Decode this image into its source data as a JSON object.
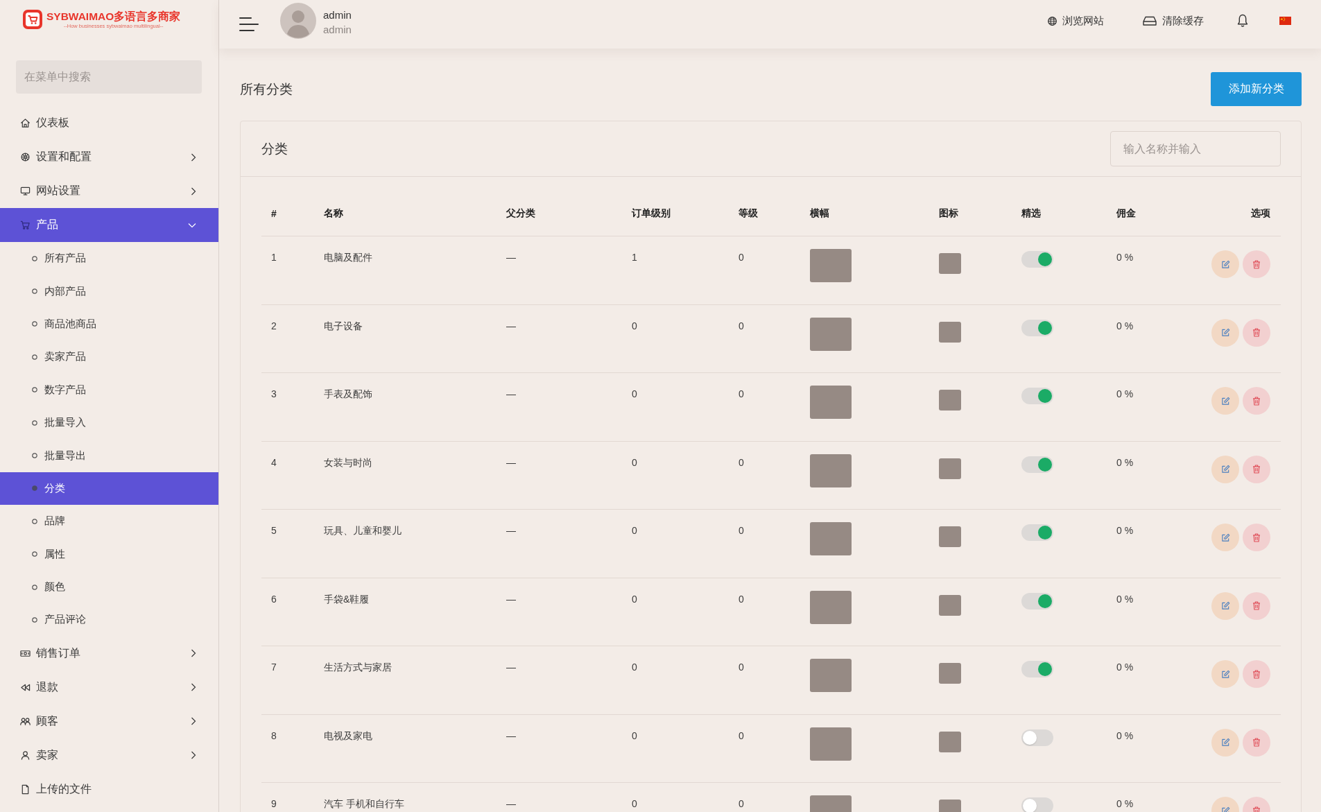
{
  "logo": {
    "title": "SYBWAIMAO多语言多商家",
    "tagline": "--How businesses sybwaimao multilingual--"
  },
  "sidebar": {
    "search": {
      "placeholder": "在菜单中搜索"
    },
    "items": [
      {
        "label": "仪表板",
        "kind": "link",
        "selected": false,
        "expanded": false
      },
      {
        "label": "设置和配置",
        "kind": "group",
        "selected": false,
        "expanded": false
      },
      {
        "label": "网站设置",
        "kind": "group",
        "selected": false,
        "expanded": false
      },
      {
        "label": "产品",
        "kind": "group",
        "selected": true,
        "expanded": true,
        "children": [
          {
            "label": "所有产品",
            "selected": false
          },
          {
            "label": "内部产品",
            "selected": false
          },
          {
            "label": "商品池商品",
            "selected": false
          },
          {
            "label": "卖家产品",
            "selected": false
          },
          {
            "label": "数字产品",
            "selected": false
          },
          {
            "label": "批量导入",
            "selected": false
          },
          {
            "label": "批量导出",
            "selected": false
          },
          {
            "label": "分类",
            "selected": true
          },
          {
            "label": "品牌",
            "selected": false
          },
          {
            "label": "属性",
            "selected": false
          },
          {
            "label": "颜色",
            "selected": false
          },
          {
            "label": "产品评论",
            "selected": false
          }
        ]
      },
      {
        "label": "销售订单",
        "kind": "group",
        "selected": false,
        "expanded": false
      },
      {
        "label": "退款",
        "kind": "group",
        "selected": false,
        "expanded": false
      },
      {
        "label": "顾客",
        "kind": "group",
        "selected": false,
        "expanded": false
      },
      {
        "label": "卖家",
        "kind": "group",
        "selected": false,
        "expanded": false
      },
      {
        "label": "上传的文件",
        "kind": "link",
        "selected": false,
        "expanded": false
      }
    ]
  },
  "header": {
    "user": {
      "name": "admin",
      "role": "admin"
    },
    "links": [
      {
        "label": "浏览网站"
      },
      {
        "label": "清除缓存"
      }
    ]
  },
  "page": {
    "title": "所有分类",
    "add_button": "添加新分类"
  },
  "card": {
    "title": "分类",
    "search": {
      "placeholder": "输入名称并输入"
    },
    "table": {
      "columns": [
        "#",
        "名称",
        "父分类",
        "订单级别",
        "等级",
        "横幅",
        "图标",
        "精选",
        "佣金",
        "选项"
      ],
      "rows": [
        {
          "number": "1",
          "name": "电脑及配件",
          "parent": "—",
          "ordering": "1",
          "rank": "0",
          "featured": true,
          "commission": "0 %"
        },
        {
          "number": "2",
          "name": "电子设备",
          "parent": "—",
          "ordering": "0",
          "rank": "0",
          "featured": true,
          "commission": "0 %"
        },
        {
          "number": "3",
          "name": "手表及配饰",
          "parent": "—",
          "ordering": "0",
          "rank": "0",
          "featured": true,
          "commission": "0 %"
        },
        {
          "number": "4",
          "name": "女装与时尚",
          "parent": "—",
          "ordering": "0",
          "rank": "0",
          "featured": true,
          "commission": "0 %"
        },
        {
          "number": "5",
          "name": "玩具、儿童和婴儿",
          "parent": "—",
          "ordering": "0",
          "rank": "0",
          "featured": true,
          "commission": "0 %"
        },
        {
          "number": "6",
          "name": "手袋&鞋履",
          "parent": "—",
          "ordering": "0",
          "rank": "0",
          "featured": true,
          "commission": "0 %"
        },
        {
          "number": "7",
          "name": "生活方式与家居",
          "parent": "—",
          "ordering": "0",
          "rank": "0",
          "featured": true,
          "commission": "0 %"
        },
        {
          "number": "8",
          "name": "电视及家电",
          "parent": "—",
          "ordering": "0",
          "rank": "0",
          "featured": false,
          "commission": "0 %"
        },
        {
          "number": "9",
          "name": "汽车 手机和自行车",
          "parent": "—",
          "ordering": "0",
          "rank": "0",
          "featured": false,
          "commission": "0 %"
        }
      ]
    }
  }
}
